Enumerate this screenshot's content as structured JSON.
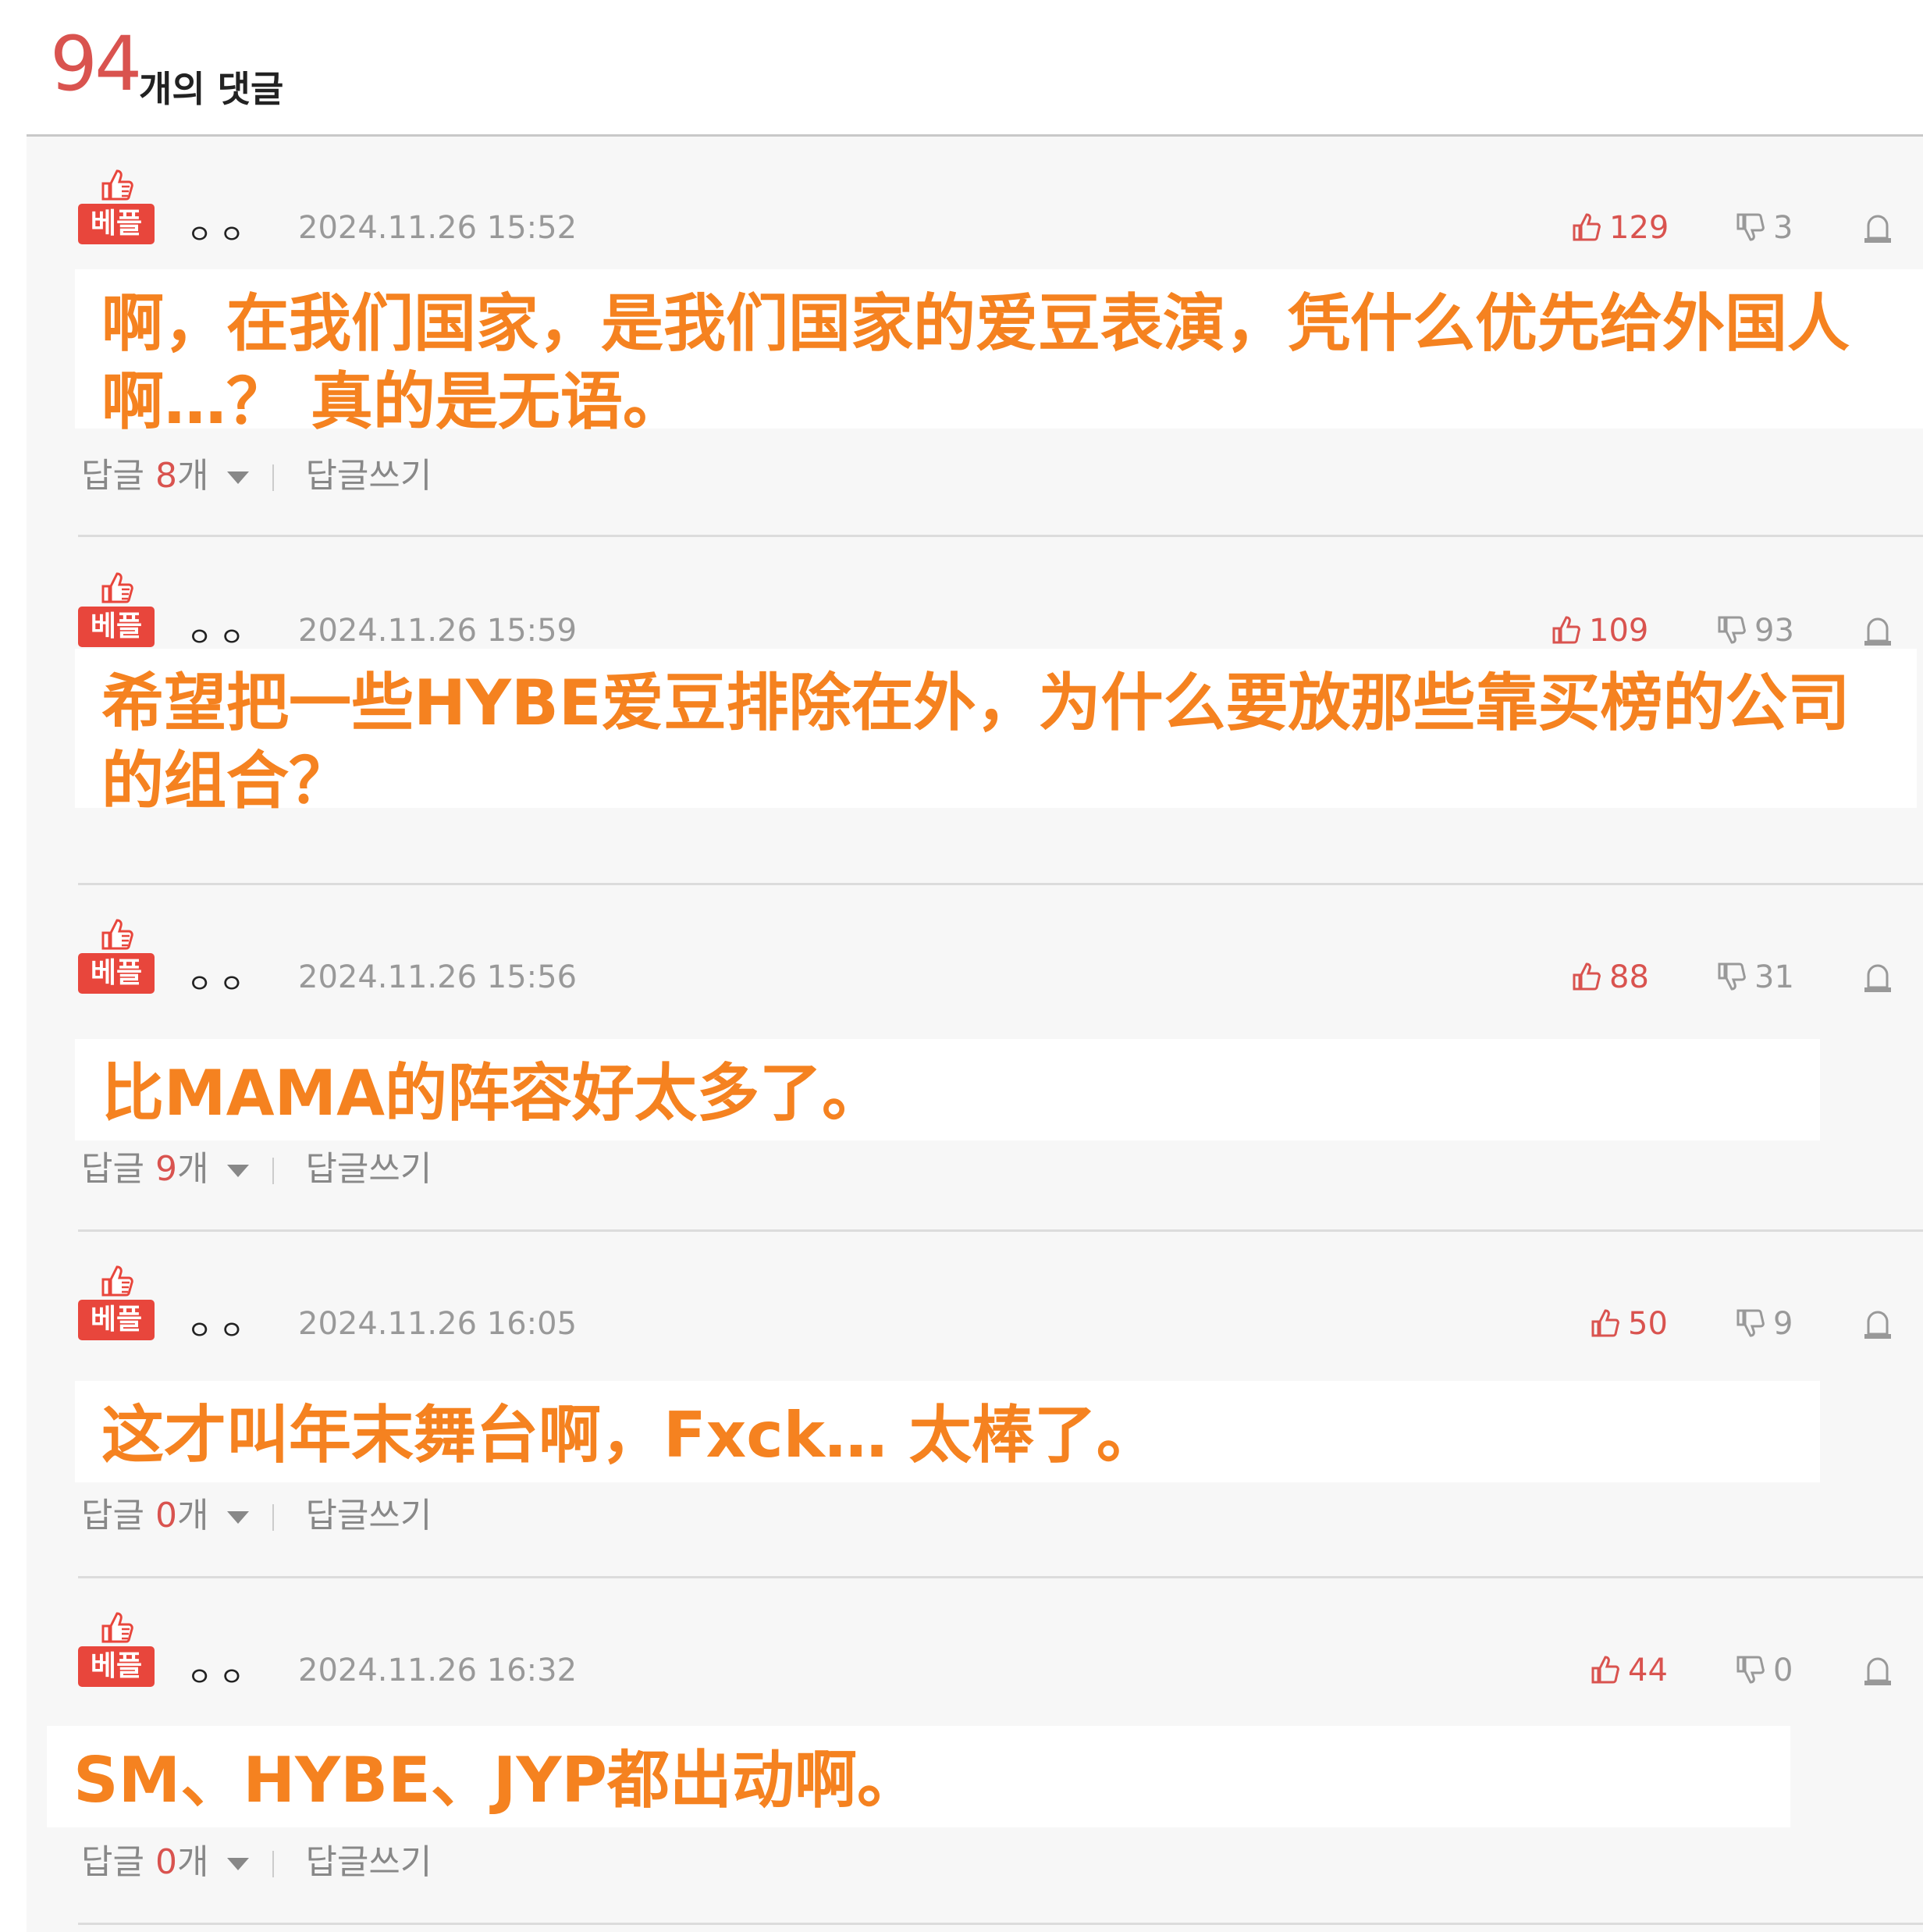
{
  "header": {
    "count": "94",
    "count_label": "개의 댓글"
  },
  "badge_label": "베플",
  "reply_word": "답글",
  "reply_unit": "개",
  "write_reply": "답글쓰기",
  "comments": [
    {
      "nick": "ㅇㅇ",
      "date": "2024.11.26 15:52",
      "likes": "129",
      "dislikes": "3",
      "replies": "8",
      "text": "啊，在我们国家，是我们国家的爱豆表演，凭什么优先给外国人啊…？ 真的是无语。"
    },
    {
      "nick": "ㅇㅇ",
      "date": "2024.11.26 15:59",
      "likes": "109",
      "dislikes": "93",
      "replies": null,
      "text": "希望把一些HYBE爱豆排除在外，为什么要放那些靠买榜的公司的组合？"
    },
    {
      "nick": "ㅇㅇ",
      "date": "2024.11.26 15:56",
      "likes": "88",
      "dislikes": "31",
      "replies": "9",
      "text": "比MAMA的阵容好太多了。"
    },
    {
      "nick": "ㅇㅇ",
      "date": "2024.11.26 16:05",
      "likes": "50",
      "dislikes": "9",
      "replies": "0",
      "text": "这才叫年末舞台啊，Fxck… 太棒了。"
    },
    {
      "nick": "ㅇㅇ",
      "date": "2024.11.26 16:32",
      "likes": "44",
      "dislikes": "0",
      "replies": "0",
      "text": "SM、HYBE、JYP都出动啊。"
    }
  ]
}
